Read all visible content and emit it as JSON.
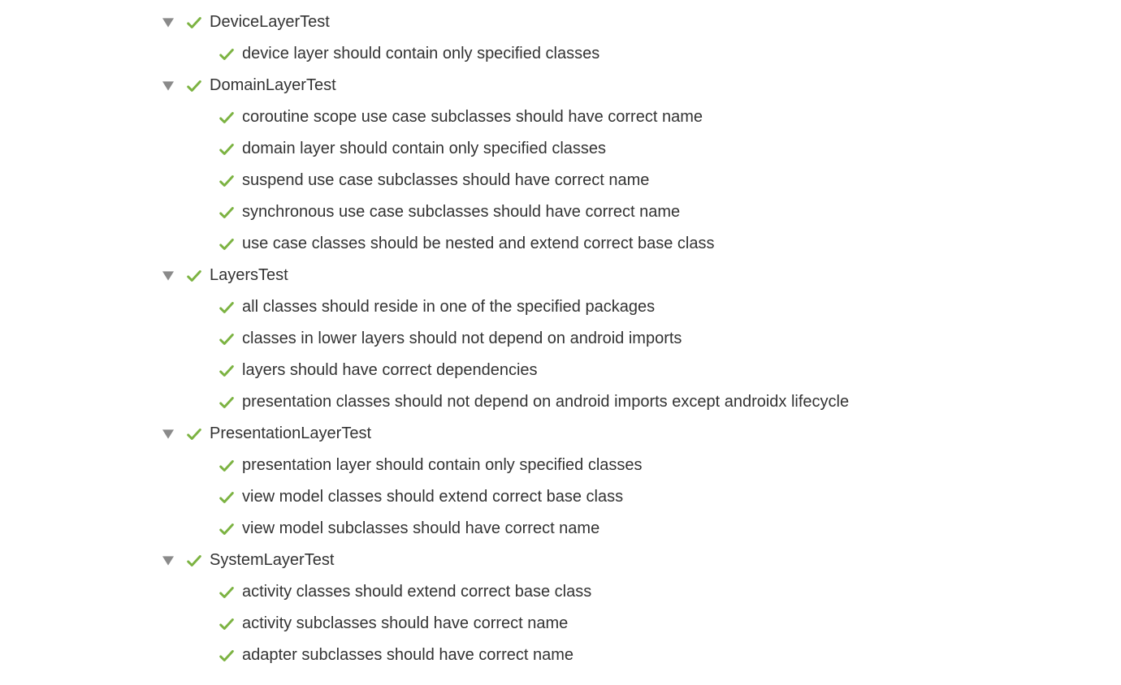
{
  "tree": [
    {
      "name": "DeviceLayerTest",
      "children": [
        "device layer should contain only specified classes"
      ]
    },
    {
      "name": "DomainLayerTest",
      "children": [
        "coroutine scope use case subclasses should have correct name",
        "domain layer should contain only specified classes",
        "suspend use case subclasses should have correct name",
        "synchronous use case subclasses should have correct name",
        "use case classes should be nested and extend correct base class"
      ]
    },
    {
      "name": "LayersTest",
      "children": [
        "all classes should reside in one of the specified packages",
        "classes in lower layers should not depend on android imports",
        "layers should have correct dependencies",
        "presentation classes should not depend on android imports except androidx lifecycle"
      ]
    },
    {
      "name": "PresentationLayerTest",
      "children": [
        "presentation layer should contain only specified classes",
        "view model classes should extend correct base class",
        "view model subclasses should have correct name"
      ]
    },
    {
      "name": "SystemLayerTest",
      "children": [
        "activity classes should extend correct base class",
        "activity subclasses should have correct name",
        "adapter subclasses should have correct name"
      ]
    }
  ]
}
